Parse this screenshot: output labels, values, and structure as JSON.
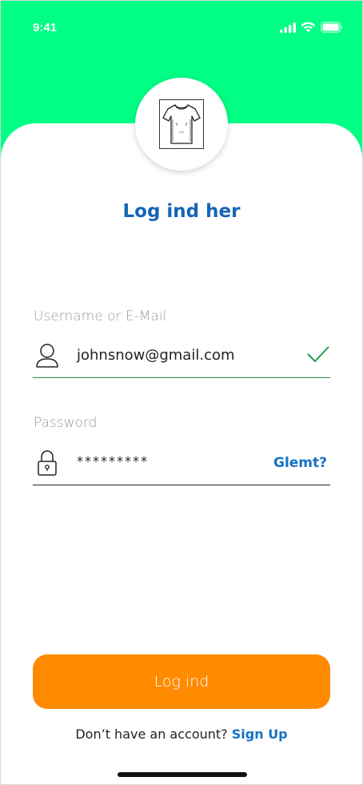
{
  "status_bar": {
    "time": "9:41",
    "signal_icon": "cellular-signal-icon",
    "wifi_icon": "wifi-icon",
    "battery_icon": "battery-icon"
  },
  "colors": {
    "header_bg": "#00ff84",
    "title": "#1565b6",
    "link": "#1572c4",
    "button": "#ff8a00",
    "valid": "#1f9a4a"
  },
  "logo": {
    "icon": "t-shirt-icon"
  },
  "title": "Log ind her",
  "email_field": {
    "label": "Username or E-Mail",
    "value": "johnsnow@gmail.com",
    "icon": "user-icon",
    "status_icon": "checkmark-icon"
  },
  "password_field": {
    "label": "Password",
    "value": "*********",
    "icon": "lock-icon",
    "forgot_label": "Glemt?"
  },
  "login_button_label": "Log ind",
  "signup": {
    "prompt": "Don’t have an account?",
    "link_label": "Sign Up"
  }
}
